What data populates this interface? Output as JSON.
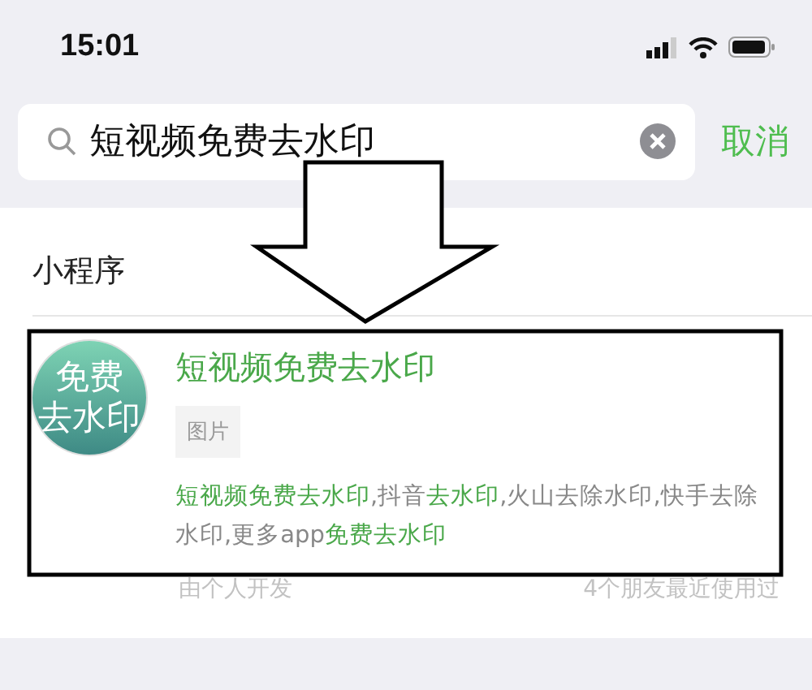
{
  "status_bar": {
    "time": "15:01"
  },
  "search": {
    "value": "短视频免费去水印",
    "cancel": "取消"
  },
  "section": {
    "title": "小程序"
  },
  "result": {
    "icon_text": [
      "免费",
      "去水印"
    ],
    "title": "短视频免费去水印",
    "tag": "图片",
    "description": [
      {
        "text": "短视频免费去水印",
        "highlight": true
      },
      {
        "text": ",抖音",
        "highlight": false
      },
      {
        "text": "去水印",
        "highlight": true
      },
      {
        "text": ",火山去除水印,快手去除水印,更多app",
        "highlight": false
      },
      {
        "text": "免费去水印",
        "highlight": true
      }
    ],
    "developer": "由个人开发",
    "friends": "4个朋友最近使用过"
  },
  "overlay": {
    "arrow": true,
    "frame": true
  }
}
